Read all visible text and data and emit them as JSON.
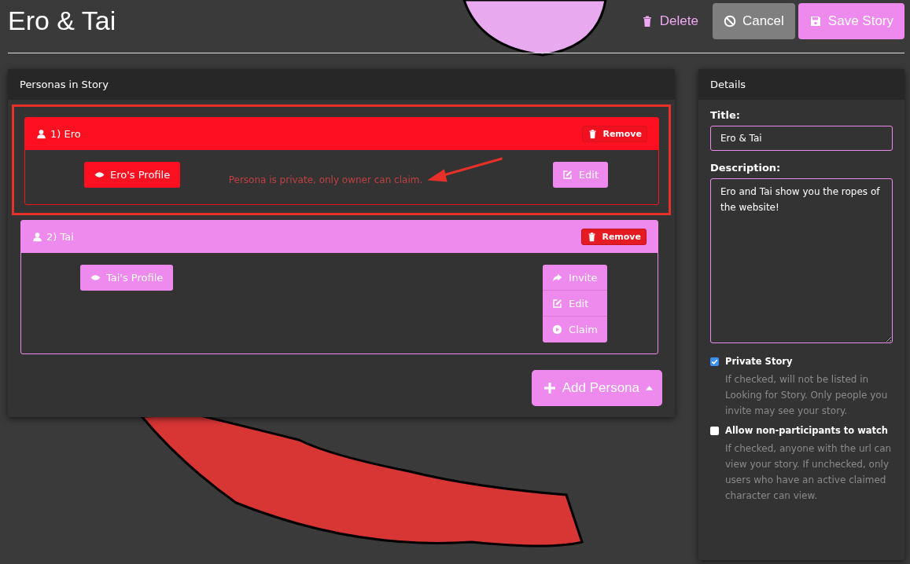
{
  "page_title": "Ero & Tai",
  "header_actions": [
    {
      "kind": "link",
      "label": "Delete"
    },
    {
      "kind": "grey",
      "label": "Cancel"
    },
    {
      "kind": "primary",
      "label": "Save Story"
    }
  ],
  "personas_panel": {
    "title": "Personas in Story",
    "personas": [
      {
        "name": "1) Ero",
        "private": true,
        "annotated": true,
        "remove_label": "Remove",
        "profile_label": "Ero's Profile",
        "note": "Persona is private, only owner can claim.",
        "actions": [
          {
            "kind": "edit",
            "label": "Edit"
          }
        ]
      },
      {
        "name": "2) Tai",
        "private": false,
        "annotated": false,
        "remove_label": "Remove",
        "profile_label": "Tai's Profile",
        "actions": [
          {
            "kind": "invite",
            "label": "Invite"
          },
          {
            "kind": "edit",
            "label": "Edit"
          },
          {
            "kind": "claim",
            "label": "Claim"
          }
        ]
      }
    ],
    "add_button": "Add Persona"
  },
  "details_panel": {
    "title": "Details",
    "title_label": "Title:",
    "title_value": "Ero & Tai",
    "description_label": "Description:",
    "description_value": "Ero and Tai show you the ropes of the website!",
    "options": [
      {
        "label": "Private Story",
        "checked": true,
        "help": "If checked, will not be listed in Looking for Story. Only people you invite may see your story."
      },
      {
        "label": "Allow non-participants to watch",
        "checked": false,
        "help": "If checked, anyone with the url can view your story. If unchecked, only users who have an active claimed character can view."
      }
    ]
  }
}
